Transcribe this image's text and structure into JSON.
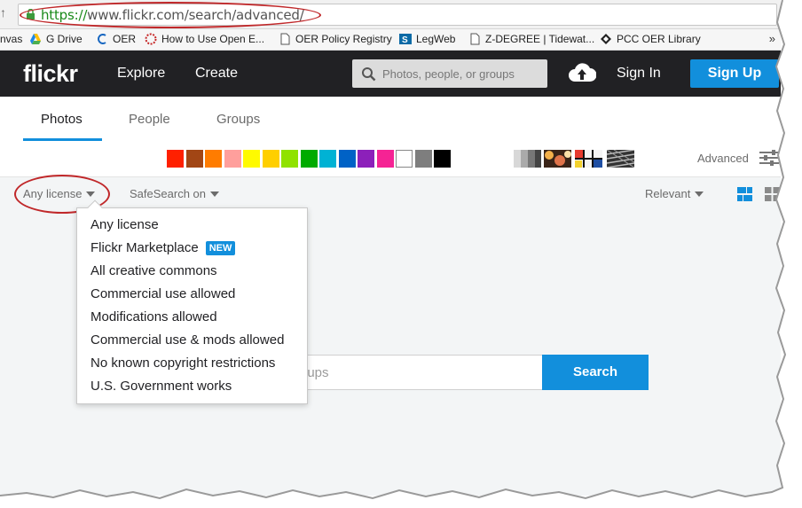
{
  "browser": {
    "url_scheme": "https://",
    "url_rest": "www.flickr.com/search/advanced/",
    "bookmarks": [
      {
        "label": "nvas",
        "icon": "canvas-icon"
      },
      {
        "label": "G Drive",
        "icon": "google-drive-icon"
      },
      {
        "label": "OER",
        "icon": "oer-icon"
      },
      {
        "label": "How to Use Open E...",
        "icon": "dotted-circle-icon"
      },
      {
        "label": "OER Policy Registry",
        "icon": "page-icon"
      },
      {
        "label": "LegWeb",
        "icon": "sharepoint-icon"
      },
      {
        "label": "Z-DEGREE | Tidewat...",
        "icon": "page-icon"
      },
      {
        "label": "PCC OER Library",
        "icon": "diamond-icon"
      }
    ],
    "more": "»"
  },
  "header": {
    "logo": "flickr",
    "nav_explore": "Explore",
    "nav_create": "Create",
    "search_placeholder": "Photos, people, or groups",
    "sign_in": "Sign In",
    "sign_up": "Sign Up"
  },
  "tabs": {
    "photos": "Photos",
    "people": "People",
    "groups": "Groups"
  },
  "colors": [
    "#ff2000",
    "#a24615",
    "#ff7c00",
    "#ff9f9c",
    "#fffa00",
    "#ffcf00",
    "#90e200",
    "#00ab00",
    "#00b2d4",
    "#0062c6",
    "#8c20ba",
    "#f52394",
    "#ffffff",
    "#7e7e7e",
    "#000000"
  ],
  "advanced_label": "Advanced",
  "filters": {
    "license": "Any license",
    "safesearch": "SafeSearch on",
    "sort": "Relevant"
  },
  "license_menu": {
    "items": [
      "Any license",
      "Flickr Marketplace",
      "All creative commons",
      "Commercial use allowed",
      "Modifications allowed",
      "Commercial use & mods allowed",
      "No known copyright restrictions",
      "U.S. Government works"
    ],
    "new_badge": "NEW"
  },
  "main_search": {
    "placeholder_visible": "roups",
    "button": "Search"
  }
}
